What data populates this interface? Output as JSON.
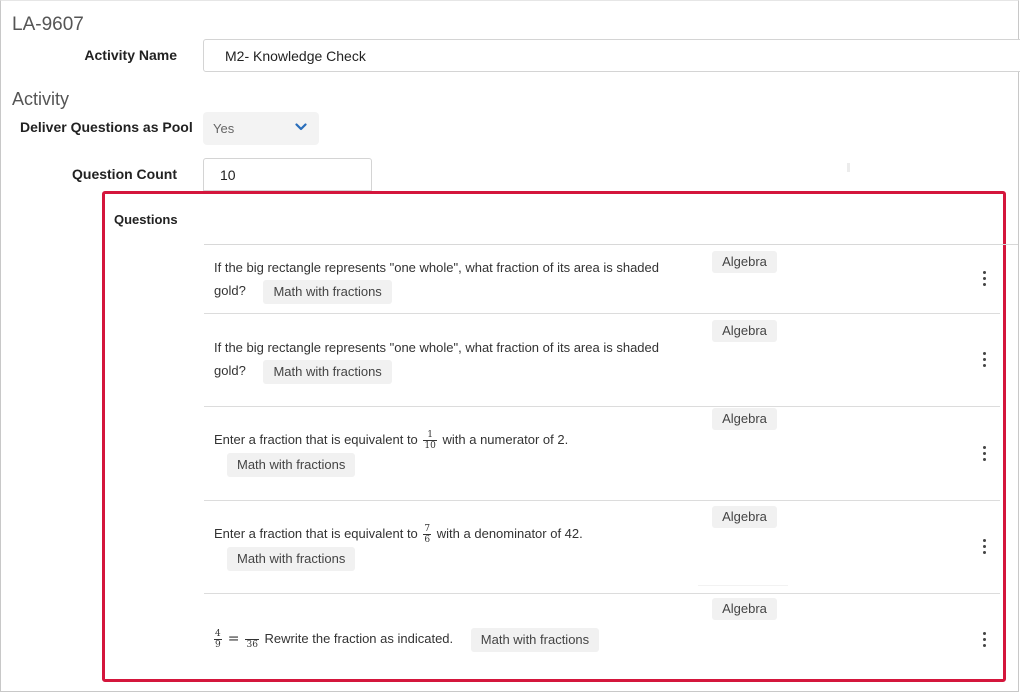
{
  "page": {
    "id_label": "LA-9607"
  },
  "activity_name": {
    "label": "Activity Name",
    "value": "M2- Knowledge Check"
  },
  "section": {
    "title": "Activity"
  },
  "deliver_pool": {
    "label": "Deliver Questions as Pool",
    "selected": "Yes"
  },
  "question_count": {
    "label": "Question Count",
    "value": "10"
  },
  "questions": {
    "label": "Questions",
    "items": [
      {
        "text_before": "If the big rectangle represents \"one whole\", what fraction of its area is shaded gold?",
        "tag": "Math with fractions",
        "category": "Algebra"
      },
      {
        "text_before": "If the big rectangle represents \"one whole\", what fraction of its area is shaded gold?",
        "tag": "Math with fractions",
        "category": "Algebra"
      },
      {
        "text_before": "Enter a fraction that is equivalent to",
        "fraction": {
          "num": "1",
          "den": "10"
        },
        "text_after": "with a numerator of 2.",
        "tag": "Math with fractions",
        "category": "Algebra"
      },
      {
        "text_before": "Enter a fraction that is equivalent to",
        "fraction": {
          "num": "7",
          "den": "6"
        },
        "text_after": "with a denominator of 42.",
        "tag": "Math with fractions",
        "category": "Algebra"
      },
      {
        "fraction": {
          "num": "4",
          "den": "9"
        },
        "equals": "=",
        "fraction2": {
          "num": "",
          "den": "36"
        },
        "text_after": "Rewrite the fraction as indicated.",
        "tag": "Math with fractions",
        "category": "Algebra"
      }
    ]
  },
  "icons": {
    "select_caret": "chevron-down-icon",
    "row_menu": "kebab-menu-icon"
  },
  "colors": {
    "highlight_border": "#d4163c",
    "caret_blue": "#2a6ebb",
    "tag_background": "#f1f1f1"
  }
}
